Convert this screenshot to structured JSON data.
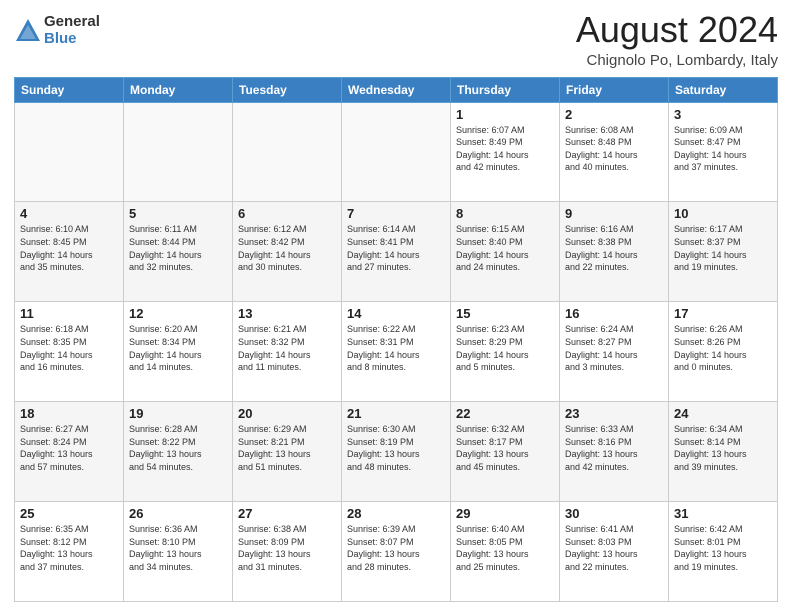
{
  "logo": {
    "general": "General",
    "blue": "Blue"
  },
  "header": {
    "month": "August 2024",
    "location": "Chignolo Po, Lombardy, Italy"
  },
  "weekdays": [
    "Sunday",
    "Monday",
    "Tuesday",
    "Wednesday",
    "Thursday",
    "Friday",
    "Saturday"
  ],
  "weeks": [
    [
      {
        "day": "",
        "info": ""
      },
      {
        "day": "",
        "info": ""
      },
      {
        "day": "",
        "info": ""
      },
      {
        "day": "",
        "info": ""
      },
      {
        "day": "1",
        "info": "Sunrise: 6:07 AM\nSunset: 8:49 PM\nDaylight: 14 hours\nand 42 minutes."
      },
      {
        "day": "2",
        "info": "Sunrise: 6:08 AM\nSunset: 8:48 PM\nDaylight: 14 hours\nand 40 minutes."
      },
      {
        "day": "3",
        "info": "Sunrise: 6:09 AM\nSunset: 8:47 PM\nDaylight: 14 hours\nand 37 minutes."
      }
    ],
    [
      {
        "day": "4",
        "info": "Sunrise: 6:10 AM\nSunset: 8:45 PM\nDaylight: 14 hours\nand 35 minutes."
      },
      {
        "day": "5",
        "info": "Sunrise: 6:11 AM\nSunset: 8:44 PM\nDaylight: 14 hours\nand 32 minutes."
      },
      {
        "day": "6",
        "info": "Sunrise: 6:12 AM\nSunset: 8:42 PM\nDaylight: 14 hours\nand 30 minutes."
      },
      {
        "day": "7",
        "info": "Sunrise: 6:14 AM\nSunset: 8:41 PM\nDaylight: 14 hours\nand 27 minutes."
      },
      {
        "day": "8",
        "info": "Sunrise: 6:15 AM\nSunset: 8:40 PM\nDaylight: 14 hours\nand 24 minutes."
      },
      {
        "day": "9",
        "info": "Sunrise: 6:16 AM\nSunset: 8:38 PM\nDaylight: 14 hours\nand 22 minutes."
      },
      {
        "day": "10",
        "info": "Sunrise: 6:17 AM\nSunset: 8:37 PM\nDaylight: 14 hours\nand 19 minutes."
      }
    ],
    [
      {
        "day": "11",
        "info": "Sunrise: 6:18 AM\nSunset: 8:35 PM\nDaylight: 14 hours\nand 16 minutes."
      },
      {
        "day": "12",
        "info": "Sunrise: 6:20 AM\nSunset: 8:34 PM\nDaylight: 14 hours\nand 14 minutes."
      },
      {
        "day": "13",
        "info": "Sunrise: 6:21 AM\nSunset: 8:32 PM\nDaylight: 14 hours\nand 11 minutes."
      },
      {
        "day": "14",
        "info": "Sunrise: 6:22 AM\nSunset: 8:31 PM\nDaylight: 14 hours\nand 8 minutes."
      },
      {
        "day": "15",
        "info": "Sunrise: 6:23 AM\nSunset: 8:29 PM\nDaylight: 14 hours\nand 5 minutes."
      },
      {
        "day": "16",
        "info": "Sunrise: 6:24 AM\nSunset: 8:27 PM\nDaylight: 14 hours\nand 3 minutes."
      },
      {
        "day": "17",
        "info": "Sunrise: 6:26 AM\nSunset: 8:26 PM\nDaylight: 14 hours\nand 0 minutes."
      }
    ],
    [
      {
        "day": "18",
        "info": "Sunrise: 6:27 AM\nSunset: 8:24 PM\nDaylight: 13 hours\nand 57 minutes."
      },
      {
        "day": "19",
        "info": "Sunrise: 6:28 AM\nSunset: 8:22 PM\nDaylight: 13 hours\nand 54 minutes."
      },
      {
        "day": "20",
        "info": "Sunrise: 6:29 AM\nSunset: 8:21 PM\nDaylight: 13 hours\nand 51 minutes."
      },
      {
        "day": "21",
        "info": "Sunrise: 6:30 AM\nSunset: 8:19 PM\nDaylight: 13 hours\nand 48 minutes."
      },
      {
        "day": "22",
        "info": "Sunrise: 6:32 AM\nSunset: 8:17 PM\nDaylight: 13 hours\nand 45 minutes."
      },
      {
        "day": "23",
        "info": "Sunrise: 6:33 AM\nSunset: 8:16 PM\nDaylight: 13 hours\nand 42 minutes."
      },
      {
        "day": "24",
        "info": "Sunrise: 6:34 AM\nSunset: 8:14 PM\nDaylight: 13 hours\nand 39 minutes."
      }
    ],
    [
      {
        "day": "25",
        "info": "Sunrise: 6:35 AM\nSunset: 8:12 PM\nDaylight: 13 hours\nand 37 minutes."
      },
      {
        "day": "26",
        "info": "Sunrise: 6:36 AM\nSunset: 8:10 PM\nDaylight: 13 hours\nand 34 minutes."
      },
      {
        "day": "27",
        "info": "Sunrise: 6:38 AM\nSunset: 8:09 PM\nDaylight: 13 hours\nand 31 minutes."
      },
      {
        "day": "28",
        "info": "Sunrise: 6:39 AM\nSunset: 8:07 PM\nDaylight: 13 hours\nand 28 minutes."
      },
      {
        "day": "29",
        "info": "Sunrise: 6:40 AM\nSunset: 8:05 PM\nDaylight: 13 hours\nand 25 minutes."
      },
      {
        "day": "30",
        "info": "Sunrise: 6:41 AM\nSunset: 8:03 PM\nDaylight: 13 hours\nand 22 minutes."
      },
      {
        "day": "31",
        "info": "Sunrise: 6:42 AM\nSunset: 8:01 PM\nDaylight: 13 hours\nand 19 minutes."
      }
    ]
  ]
}
